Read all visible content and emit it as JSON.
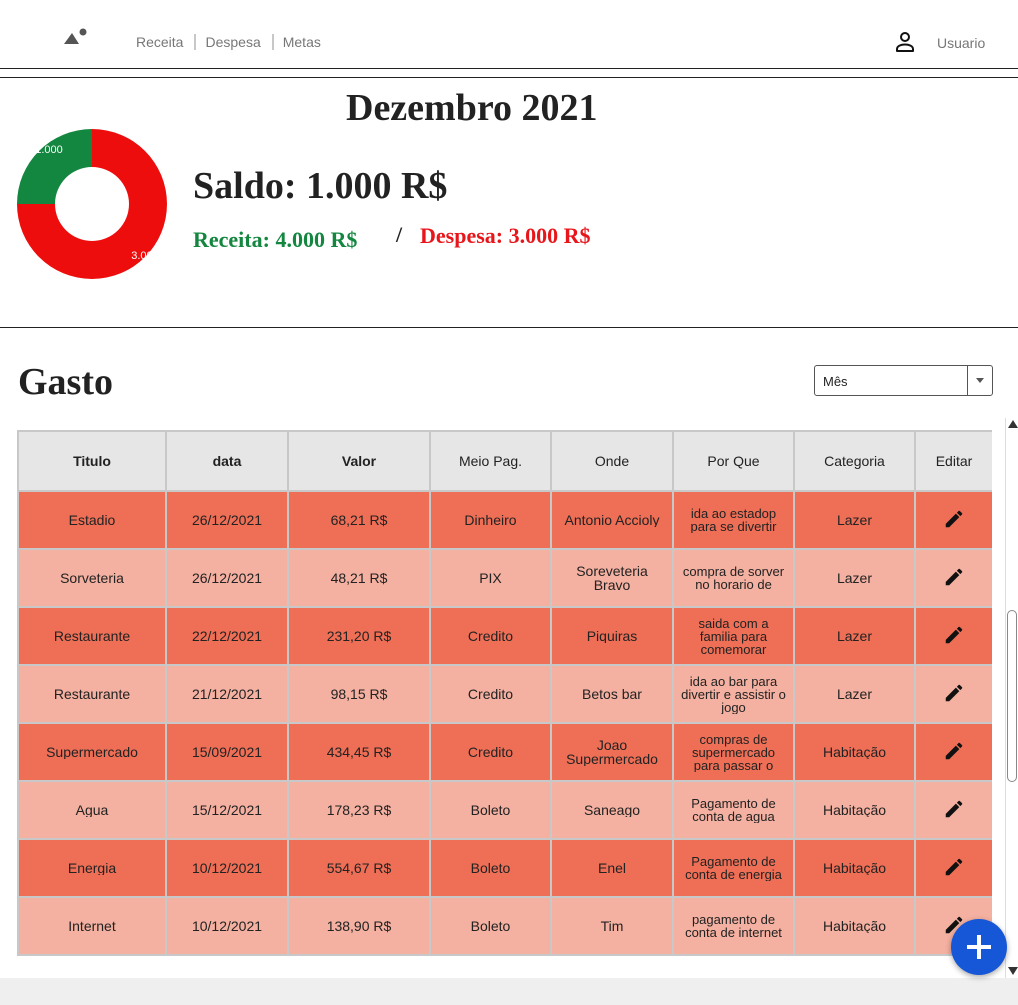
{
  "header": {
    "nav": [
      {
        "label": "Receita"
      },
      {
        "label": "Despesa"
      },
      {
        "label": "Metas"
      }
    ],
    "user_label": "Usuario",
    "logo_icon": "landscape-icon",
    "user_icon": "person-icon"
  },
  "summary": {
    "month": "Dezembro 2021",
    "saldo": "Saldo: 1.000 R$",
    "receita": "Receita: 4.000 R$",
    "separator": "/",
    "despesa": "Despesa: 3.000 R$",
    "donut": {
      "slices": [
        {
          "label": "1.000",
          "value": 1000,
          "color": "#13863f"
        },
        {
          "label": "3.000",
          "value": 3000,
          "color": "#ee0d0d"
        }
      ]
    }
  },
  "gasto": {
    "title": "Gasto",
    "filter": {
      "selected": "Mês"
    },
    "columns": [
      "Titulo",
      "data",
      "Valor",
      "Meio Pag.",
      "Onde",
      "Por Que",
      "Categoria",
      "Editar"
    ],
    "rows": [
      [
        "Estadio",
        "26/12/2021",
        "68,21 R$",
        "Dinheiro",
        "Antonio Accioly",
        "ida ao estadop para se divertir",
        "Lazer"
      ],
      [
        "Sorveteria",
        "26/12/2021",
        "48,21 R$",
        "PIX",
        "Soreveteria Bravo",
        "compra de sorver no horario de",
        "Lazer"
      ],
      [
        "Restaurante",
        "22/12/2021",
        "231,20 R$",
        "Credito",
        "Piquiras",
        "saida com a familia para comemorar",
        "Lazer"
      ],
      [
        "Restaurante",
        "21/12/2021",
        "98,15 R$",
        "Credito",
        "Betos bar",
        "ida ao bar para divertir e assistir o jogo",
        "Lazer"
      ],
      [
        "Supermercado",
        "15/09/2021",
        "434,45 R$",
        "Credito",
        "Joao Supermercado",
        "compras de supermercado para passar o",
        "Habitação"
      ],
      [
        "Agua",
        "15/12/2021",
        "178,23 R$",
        "Boleto",
        "Saneago",
        "Pagamento de conta de agua",
        "Habitação"
      ],
      [
        "Energia",
        "10/12/2021",
        "554,67 R$",
        "Boleto",
        "Enel",
        "Pagamento de conta de energia",
        "Habitação"
      ],
      [
        "Internet",
        "10/12/2021",
        "138,90 R$",
        "Boleto",
        "Tim",
        "pagamento de conta de internet",
        "Habitação"
      ]
    ],
    "edit_icon": "pencil-icon",
    "add_icon": "plus-icon"
  }
}
